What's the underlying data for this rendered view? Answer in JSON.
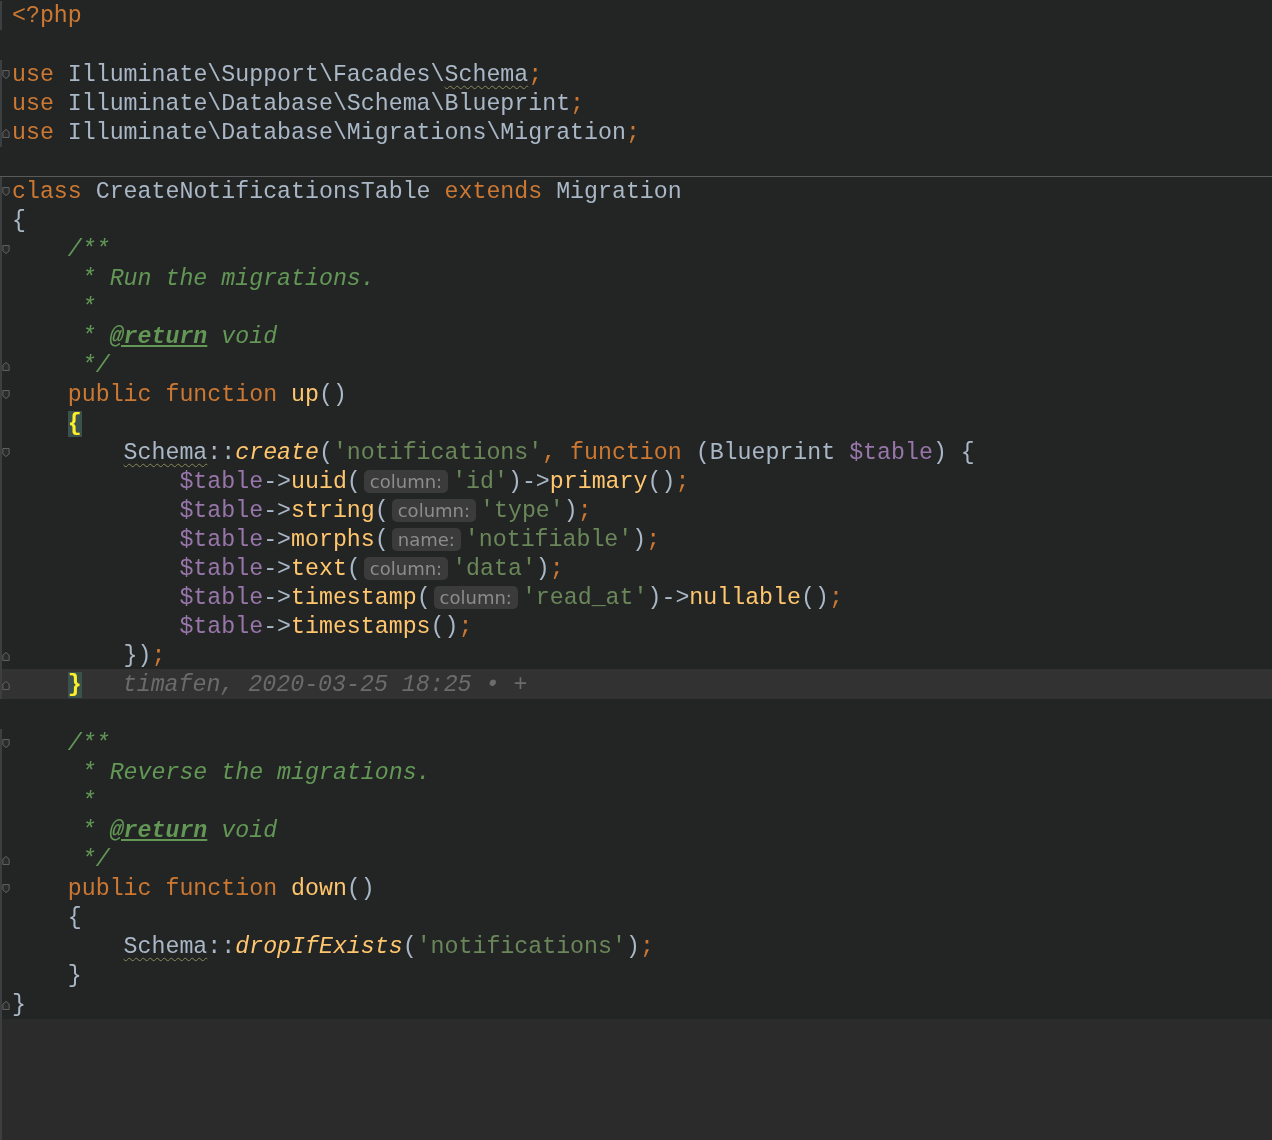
{
  "lines": [
    {
      "tokens": [
        {
          "kind": "keyword",
          "text": "<?php"
        }
      ]
    },
    {
      "blank_above": true,
      "fold_open": true,
      "tokens": [
        {
          "kind": "keyword",
          "text": "use"
        },
        {
          "kind": "plain",
          "text": " Illuminate\\Support\\Facades\\"
        },
        {
          "kind": "warn",
          "text": "Schema"
        },
        {
          "kind": "sep",
          "text": ";"
        }
      ]
    },
    {
      "tokens": [
        {
          "kind": "keyword",
          "text": "use"
        },
        {
          "kind": "plain",
          "text": " Illuminate\\Database\\Schema\\Blueprint"
        },
        {
          "kind": "sep",
          "text": ";"
        }
      ]
    },
    {
      "fold_close": true,
      "tokens": [
        {
          "kind": "keyword",
          "text": "use"
        },
        {
          "kind": "plain",
          "text": " Illuminate\\Database\\Migrations\\Migration"
        },
        {
          "kind": "sep",
          "text": ";"
        }
      ]
    },
    {
      "blank_above": true,
      "separator": true,
      "fold_open": true,
      "tokens": [
        {
          "kind": "keyword",
          "text": "class"
        },
        {
          "kind": "plain",
          "text": " CreateNotificationsTable "
        },
        {
          "kind": "keyword",
          "text": "extends"
        },
        {
          "kind": "plain",
          "text": " Migration"
        }
      ]
    },
    {
      "tokens": [
        {
          "kind": "plain",
          "text": "{"
        }
      ],
      "children": [
        {
          "fold_open": true,
          "tokens": [
            {
              "kind": "comment",
              "text": "/**"
            }
          ]
        },
        {
          "tokens": [
            {
              "kind": "comment",
              "text": " * Run the migrations."
            }
          ]
        },
        {
          "tokens": [
            {
              "kind": "comment",
              "text": " *"
            }
          ]
        },
        {
          "tokens": [
            {
              "kind": "comment",
              "text": " * "
            },
            {
              "kind": "doctag",
              "text": "@return"
            },
            {
              "kind": "comment",
              "text": " void"
            }
          ]
        },
        {
          "fold_close": true,
          "tokens": [
            {
              "kind": "comment",
              "text": " */"
            }
          ]
        },
        {
          "fold_open": true,
          "tokens": [
            {
              "kind": "keyword",
              "text": "public function "
            },
            {
              "kind": "call",
              "text": "up"
            },
            {
              "kind": "plain",
              "text": "()"
            }
          ]
        },
        {
          "tokens": [
            {
              "kind": "brace",
              "text": "{"
            }
          ],
          "children": [
            {
              "fold_open": true,
              "tokens": [
                {
                  "kind": "warn",
                  "text": "Schema"
                },
                {
                  "kind": "plain",
                  "text": "::"
                },
                {
                  "kind": "static",
                  "text": "create"
                },
                {
                  "kind": "plain",
                  "text": "("
                },
                {
                  "kind": "string",
                  "text": "'notifications'"
                },
                {
                  "kind": "sep",
                  "text": ","
                },
                {
                  "kind": "keyword",
                  "text": " function"
                },
                {
                  "kind": "plain",
                  "text": " (Blueprint "
                },
                {
                  "kind": "variable",
                  "text": "$table"
                },
                {
                  "kind": "plain",
                  "text": ") {"
                }
              ],
              "children": [
                {
                  "tokens": [
                    {
                      "kind": "variable",
                      "text": "$table"
                    },
                    {
                      "kind": "plain",
                      "text": "->"
                    },
                    {
                      "kind": "call",
                      "text": "uuid"
                    },
                    {
                      "kind": "plain",
                      "text": "("
                    },
                    {
                      "kind": "hint",
                      "text": "column:"
                    },
                    {
                      "kind": "string",
                      "text": "'id'"
                    },
                    {
                      "kind": "plain",
                      "text": ")->"
                    },
                    {
                      "kind": "call",
                      "text": "primary"
                    },
                    {
                      "kind": "plain",
                      "text": "()"
                    },
                    {
                      "kind": "sep",
                      "text": ";"
                    }
                  ]
                },
                {
                  "tokens": [
                    {
                      "kind": "variable",
                      "text": "$table"
                    },
                    {
                      "kind": "plain",
                      "text": "->"
                    },
                    {
                      "kind": "call",
                      "text": "string"
                    },
                    {
                      "kind": "plain",
                      "text": "("
                    },
                    {
                      "kind": "hint",
                      "text": "column:"
                    },
                    {
                      "kind": "string",
                      "text": "'type'"
                    },
                    {
                      "kind": "plain",
                      "text": ")"
                    },
                    {
                      "kind": "sep",
                      "text": ";"
                    }
                  ]
                },
                {
                  "tokens": [
                    {
                      "kind": "variable",
                      "text": "$table"
                    },
                    {
                      "kind": "plain",
                      "text": "->"
                    },
                    {
                      "kind": "call",
                      "text": "morphs"
                    },
                    {
                      "kind": "plain",
                      "text": "("
                    },
                    {
                      "kind": "hint",
                      "text": "name:"
                    },
                    {
                      "kind": "string",
                      "text": "'notifiable'"
                    },
                    {
                      "kind": "plain",
                      "text": ")"
                    },
                    {
                      "kind": "sep",
                      "text": ";"
                    }
                  ]
                },
                {
                  "tokens": [
                    {
                      "kind": "variable",
                      "text": "$table"
                    },
                    {
                      "kind": "plain",
                      "text": "->"
                    },
                    {
                      "kind": "call",
                      "text": "text"
                    },
                    {
                      "kind": "plain",
                      "text": "("
                    },
                    {
                      "kind": "hint",
                      "text": "column:"
                    },
                    {
                      "kind": "string",
                      "text": "'data'"
                    },
                    {
                      "kind": "plain",
                      "text": ")"
                    },
                    {
                      "kind": "sep",
                      "text": ";"
                    }
                  ]
                },
                {
                  "tokens": [
                    {
                      "kind": "variable",
                      "text": "$table"
                    },
                    {
                      "kind": "plain",
                      "text": "->"
                    },
                    {
                      "kind": "call",
                      "text": "timestamp"
                    },
                    {
                      "kind": "plain",
                      "text": "("
                    },
                    {
                      "kind": "hint",
                      "text": "column:"
                    },
                    {
                      "kind": "string",
                      "text": "'read_at'"
                    },
                    {
                      "kind": "plain",
                      "text": ")->"
                    },
                    {
                      "kind": "call",
                      "text": "nullable"
                    },
                    {
                      "kind": "plain",
                      "text": "()"
                    },
                    {
                      "kind": "sep",
                      "text": ";"
                    }
                  ]
                },
                {
                  "tokens": [
                    {
                      "kind": "variable",
                      "text": "$table"
                    },
                    {
                      "kind": "plain",
                      "text": "->"
                    },
                    {
                      "kind": "call",
                      "text": "timestamps"
                    },
                    {
                      "kind": "plain",
                      "text": "()"
                    },
                    {
                      "kind": "sep",
                      "text": ";"
                    }
                  ]
                }
              ]
            },
            {
              "fold_close": true,
              "tokens": [
                {
                  "kind": "plain",
                  "text": "})"
                },
                {
                  "kind": "sep",
                  "text": ";"
                }
              ]
            }
          ]
        },
        {
          "fold_close": true,
          "current": true,
          "annotation": "timafen, 2020-03-25 18:25 • +",
          "tokens": [
            {
              "kind": "brace",
              "text": "}"
            }
          ]
        },
        {
          "blank_above": true,
          "fold_open": true,
          "tokens": [
            {
              "kind": "comment",
              "text": "/**"
            }
          ]
        },
        {
          "tokens": [
            {
              "kind": "comment",
              "text": " * Reverse the migrations."
            }
          ]
        },
        {
          "tokens": [
            {
              "kind": "comment",
              "text": " *"
            }
          ]
        },
        {
          "tokens": [
            {
              "kind": "comment",
              "text": " * "
            },
            {
              "kind": "doctag",
              "text": "@return"
            },
            {
              "kind": "comment",
              "text": " void"
            }
          ]
        },
        {
          "fold_close": true,
          "tokens": [
            {
              "kind": "comment",
              "text": " */"
            }
          ]
        },
        {
          "fold_open": true,
          "tokens": [
            {
              "kind": "keyword",
              "text": "public function "
            },
            {
              "kind": "call",
              "text": "down"
            },
            {
              "kind": "plain",
              "text": "()"
            }
          ]
        },
        {
          "tokens": [
            {
              "kind": "plain",
              "text": "{"
            }
          ],
          "children": [
            {
              "tokens": [
                {
                  "kind": "warn",
                  "text": "Schema"
                },
                {
                  "kind": "plain",
                  "text": "::"
                },
                {
                  "kind": "static",
                  "text": "dropIfExists"
                },
                {
                  "kind": "plain",
                  "text": "("
                },
                {
                  "kind": "string",
                  "text": "'notifications'"
                },
                {
                  "kind": "plain",
                  "text": ")"
                },
                {
                  "kind": "sep",
                  "text": ";"
                }
              ]
            }
          ]
        },
        {
          "tokens": [
            {
              "kind": "plain",
              "text": "}"
            }
          ]
        }
      ]
    },
    {
      "fold_close": true,
      "tokens": [
        {
          "kind": "plain",
          "text": "}"
        }
      ]
    }
  ]
}
